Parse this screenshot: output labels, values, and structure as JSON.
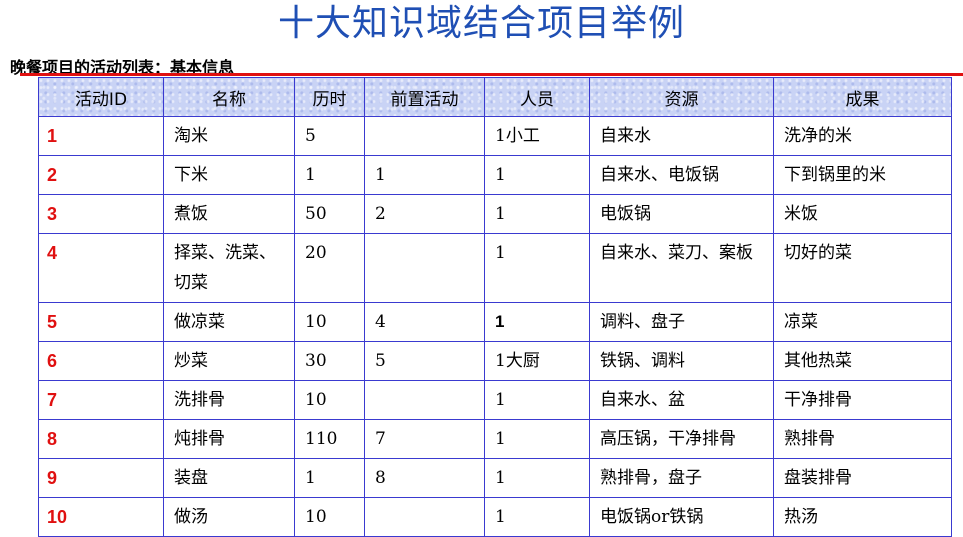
{
  "title": "十大知识域结合项目举例",
  "subtitle": "晚餐项目的活动列表：基本信息",
  "table": {
    "headers": [
      "活动ID",
      "名称",
      "历时",
      "前置活动",
      "人员",
      "资源",
      "成果"
    ],
    "rows": [
      {
        "id": "1",
        "name": "淘米",
        "duration": "5",
        "predecessor": "",
        "staff": "1小工",
        "resource": "自来水",
        "result": "洗净的米"
      },
      {
        "id": "2",
        "name": "下米",
        "duration": "1",
        "predecessor": "1",
        "staff": "1",
        "resource": "自来水、电饭锅",
        "result": "下到锅里的米"
      },
      {
        "id": "3",
        "name": "煮饭",
        "duration": "50",
        "predecessor": "2",
        "staff": "1",
        "resource": "电饭锅",
        "result": "米饭"
      },
      {
        "id": "4",
        "name": "择菜、洗菜、切菜",
        "duration": "20",
        "predecessor": "",
        "staff": "1",
        "resource": "自来水、菜刀、案板",
        "result": "切好的菜"
      },
      {
        "id": "5",
        "name": "做凉菜",
        "duration": "10",
        "predecessor": "4",
        "staff": "1",
        "resource": "调料、盘子",
        "result": "凉菜"
      },
      {
        "id": "6",
        "name": "炒菜",
        "duration": "30",
        "predecessor": "5",
        "staff": "1大厨",
        "resource": "铁锅、调料",
        "result": "其他热菜"
      },
      {
        "id": "7",
        "name": "洗排骨",
        "duration": "10",
        "predecessor": "",
        "staff": "1",
        "resource": "自来水、盆",
        "result": "干净排骨"
      },
      {
        "id": "8",
        "name": "炖排骨",
        "duration": "110",
        "predecessor": "7",
        "staff": "1",
        "resource": "高压锅，干净排骨",
        "result": "熟排骨"
      },
      {
        "id": "9",
        "name": "装盘",
        "duration": "1",
        "predecessor": "8",
        "staff": "1",
        "resource": "熟排骨，盘子",
        "result": "盘装排骨"
      },
      {
        "id": "10",
        "name": "做汤",
        "duration": "10",
        "predecessor": "",
        "staff": "1",
        "resource": "电饭锅or铁锅",
        "result": "热汤"
      }
    ]
  }
}
